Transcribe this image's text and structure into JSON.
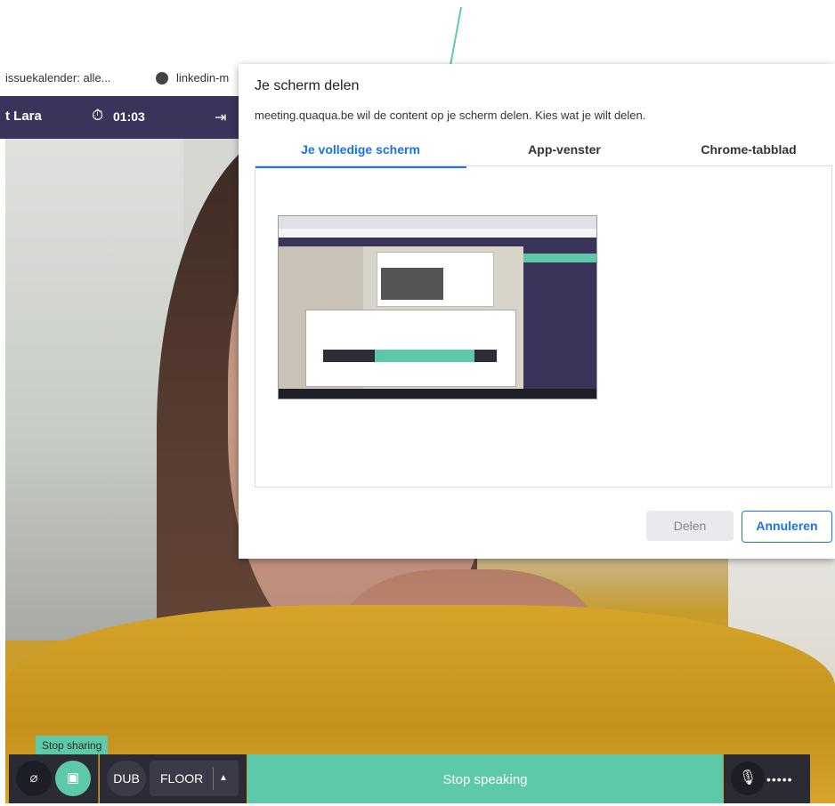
{
  "bookmarks": {
    "item1": "issuekalender: alle...",
    "item2": "linkedin-m"
  },
  "meeting_bar": {
    "name": "t Lara",
    "timer_icon": "stopwatch-icon",
    "timer": "01:03",
    "exit_icon": "exit-icon"
  },
  "dialog": {
    "title": "Je scherm delen",
    "subtitle": "meeting.quaqua.be wil de content op je scherm delen. Kies wat je wilt delen.",
    "tabs": [
      {
        "label": "Je volledige scherm",
        "active": true
      },
      {
        "label": "App-venster",
        "active": false
      },
      {
        "label": "Chrome-tabblad",
        "active": false
      }
    ],
    "share_button": "Delen",
    "cancel_button": "Annuleren"
  },
  "controls": {
    "tooltip": "Stop sharing",
    "dub_label": "DUB",
    "floor_label": "FLOOR",
    "floor_caret": "▲",
    "speak_label": "Stop speaking",
    "mic_icon": "microphone-icon",
    "level_text": "•••••"
  },
  "colors": {
    "accent": "#5ec9a8",
    "bar": "#3a345a",
    "dialog_accent": "#1a73e8"
  }
}
